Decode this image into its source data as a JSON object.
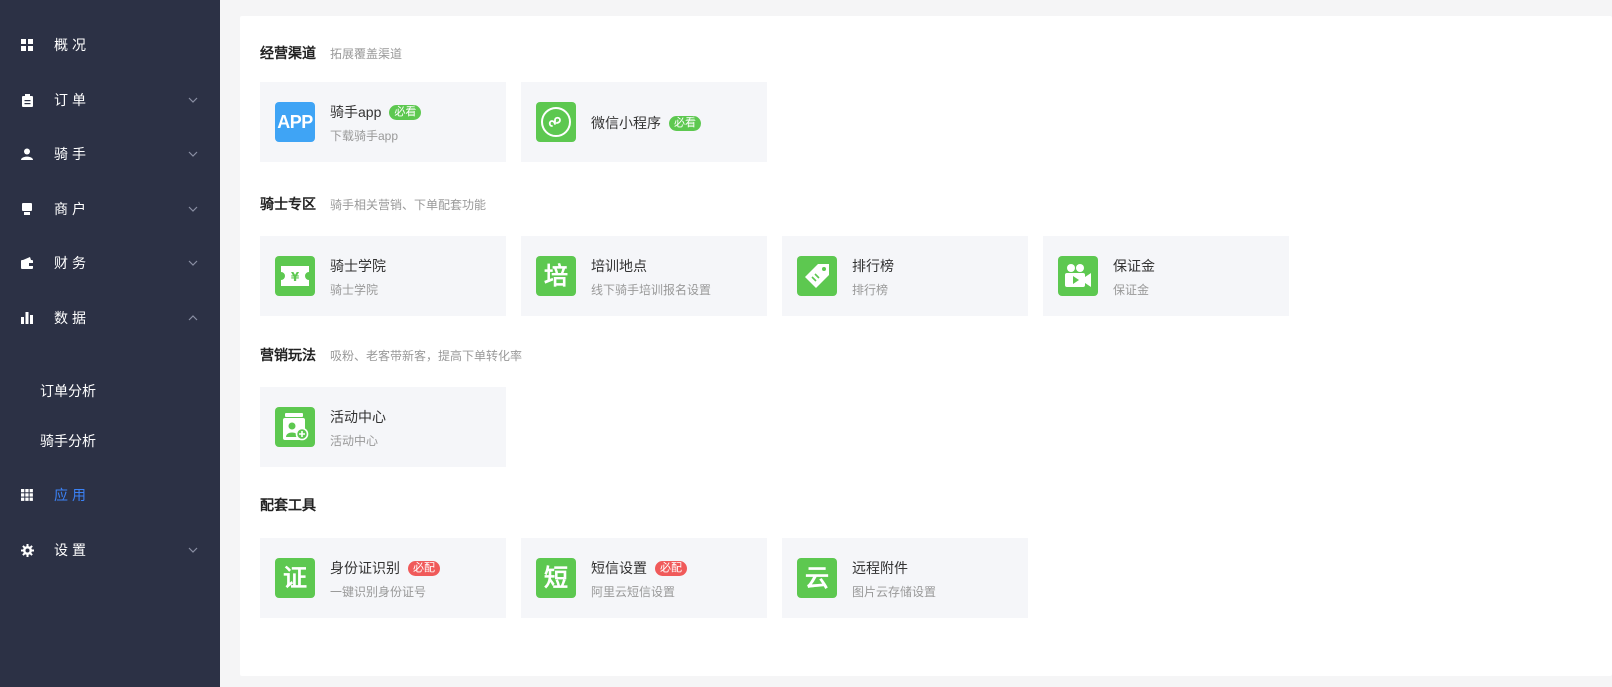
{
  "sidebar": {
    "items": [
      {
        "label": "概况",
        "icon": "grid-icon"
      },
      {
        "label": "订单",
        "icon": "clipboard-icon"
      },
      {
        "label": "骑手",
        "icon": "user-icon"
      },
      {
        "label": "商户",
        "icon": "store-icon"
      },
      {
        "label": "财务",
        "icon": "wallet-icon"
      },
      {
        "label": "数据",
        "icon": "bar-chart-icon"
      },
      {
        "label": "应用",
        "icon": "apps-icon"
      },
      {
        "label": "设置",
        "icon": "gear-icon"
      }
    ],
    "sub_items": [
      {
        "label": "订单分析"
      },
      {
        "label": "骑手分析"
      }
    ],
    "active": "应用",
    "active_color": "#3b82f6"
  },
  "sections": [
    {
      "title": "经营渠道",
      "desc": "拓展覆盖渠道",
      "tiles": [
        {
          "name": "骑手app",
          "sub": "下载骑手app",
          "badge": "必看",
          "icon": "app-icon"
        },
        {
          "name": "微信小程序",
          "sub": "",
          "badge": "必看",
          "icon": "mini-program-icon"
        }
      ]
    },
    {
      "title": "骑士专区",
      "desc": "骑手相关营销、下单配套功能",
      "tiles": [
        {
          "name": "骑士学院",
          "sub": "骑士学院",
          "icon": "ticket-yen-icon"
        },
        {
          "name": "培训地点",
          "sub": "线下骑手培训报名设置",
          "glyph": "培",
          "icon": "training-icon"
        },
        {
          "name": "排行榜",
          "sub": "排行榜",
          "icon": "tag-icon"
        },
        {
          "name": "保证金",
          "sub": "保证金",
          "icon": "video-camera-icon"
        }
      ]
    },
    {
      "title": "营销玩法",
      "desc": "吸粉、老客带新客，提高下单转化率",
      "tiles": [
        {
          "name": "活动中心",
          "sub": "活动中心",
          "icon": "activity-icon"
        }
      ]
    },
    {
      "title": "配套工具",
      "desc": "",
      "tiles": [
        {
          "name": "身份证识别",
          "sub": "一键识别身份证号",
          "badge": "必配",
          "glyph": "证",
          "icon": "id-card-icon"
        },
        {
          "name": "短信设置",
          "sub": "阿里云短信设置",
          "badge": "必配",
          "glyph": "短",
          "icon": "sms-icon"
        },
        {
          "name": "远程附件",
          "sub": "图片云存储设置",
          "glyph": "云",
          "icon": "cloud-icon"
        }
      ]
    }
  ],
  "app_icon_text": "APP",
  "colors": {
    "sidebar_bg": "#2c3145",
    "icon_green": "#5dc850",
    "icon_blue": "#3fa4f5",
    "badge_green": "#5dc850",
    "badge_red": "#f05a5a"
  }
}
